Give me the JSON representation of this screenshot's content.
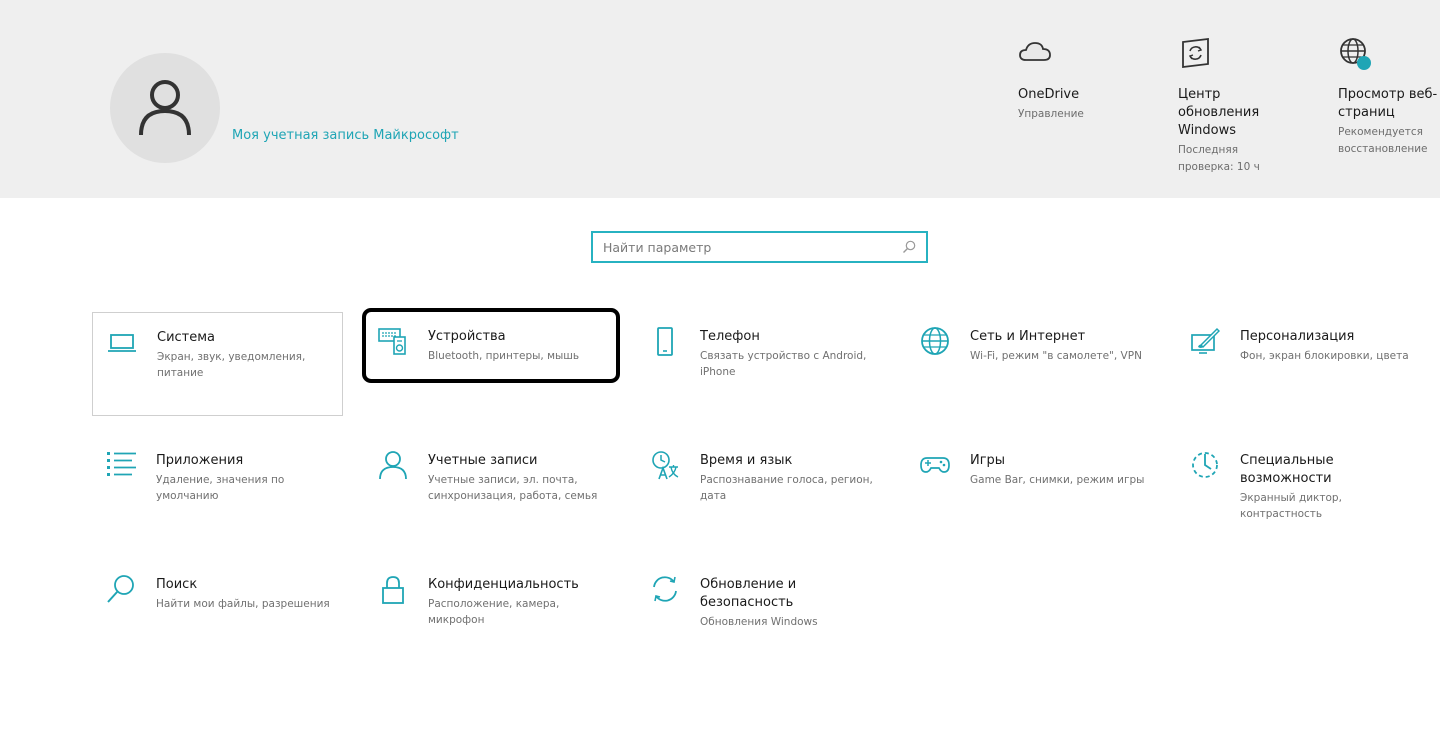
{
  "account": {
    "link_label": "Моя учетная запись Майкрософт"
  },
  "quick": [
    {
      "title": "OneDrive",
      "sub": "Управление",
      "icon": "cloud-icon"
    },
    {
      "title": "Центр обновления Windows",
      "sub": "Последняя проверка: 10 ч",
      "icon": "windows-update-icon"
    },
    {
      "title": "Просмотр веб-страниц",
      "sub": "Рекомендуется восстановление",
      "icon": "globe-badge-icon"
    }
  ],
  "search": {
    "placeholder": "Найти параметр"
  },
  "tiles": [
    {
      "name": "Система",
      "desc": "Экран, звук, уведомления, питание",
      "icon": "laptop-icon"
    },
    {
      "name": "Устройства",
      "desc": "Bluetooth, принтеры, мышь",
      "icon": "devices-icon"
    },
    {
      "name": "Телефон",
      "desc": "Связать устройство с Android, iPhone",
      "icon": "phone-icon"
    },
    {
      "name": "Сеть и Интернет",
      "desc": "Wi-Fi, режим \"в самолете\", VPN",
      "icon": "globe-icon"
    },
    {
      "name": "Персонализация",
      "desc": "Фон, экран блокировки, цвета",
      "icon": "paint-icon"
    },
    {
      "name": "Приложения",
      "desc": "Удаление, значения по умолчанию",
      "icon": "apps-list-icon"
    },
    {
      "name": "Учетные записи",
      "desc": "Учетные записи, эл. почта, синхронизация, работа, семья",
      "icon": "person-icon"
    },
    {
      "name": "Время и язык",
      "desc": "Распознавание голоса, регион, дата",
      "icon": "time-language-icon"
    },
    {
      "name": "Игры",
      "desc": "Game Bar, снимки, режим игры",
      "icon": "gamepad-icon"
    },
    {
      "name": "Специальные возможности",
      "desc": "Экранный диктор, контрастность",
      "icon": "accessibility-icon"
    },
    {
      "name": "Поиск",
      "desc": "Найти мои файлы, разрешения",
      "icon": "search-icon"
    },
    {
      "name": "Конфиденциальность",
      "desc": "Расположение, камера, микрофон",
      "icon": "lock-icon"
    },
    {
      "name": "Обновление и безопасность",
      "desc": "Обновления Windows",
      "icon": "sync-icon"
    }
  ],
  "colors": {
    "accent": "#1fa5b5",
    "header_bg": "#efefef"
  }
}
